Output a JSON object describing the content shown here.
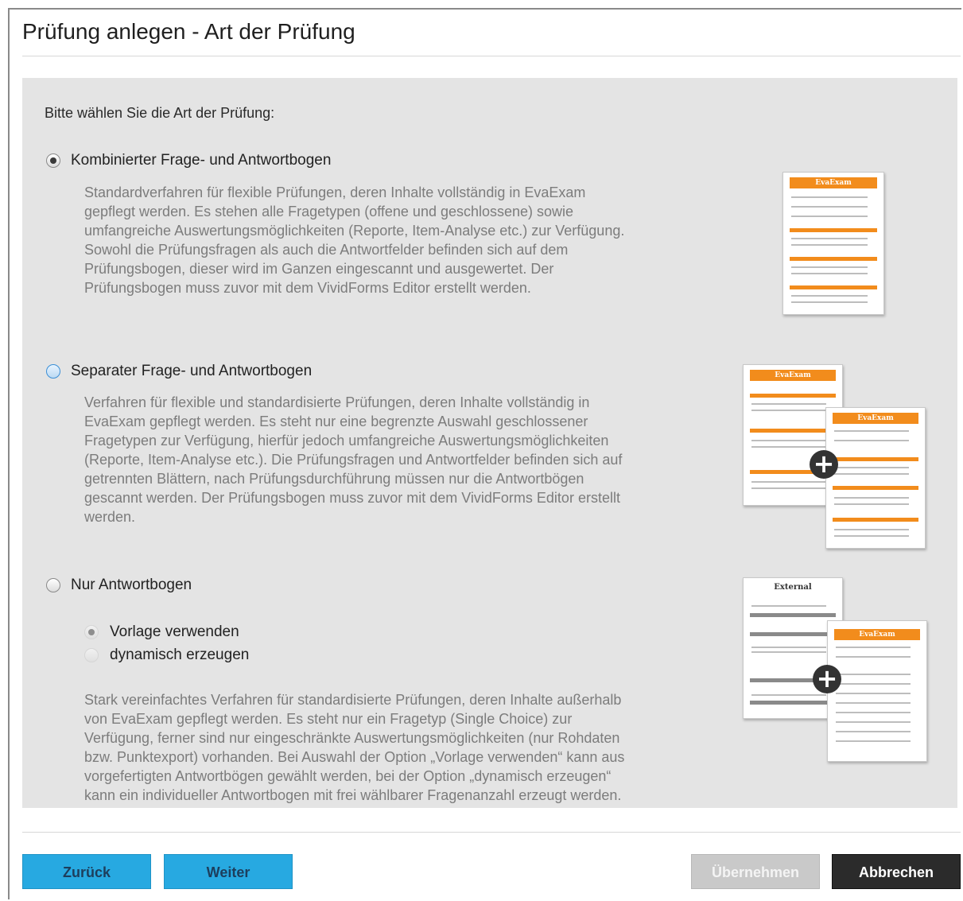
{
  "dialog": {
    "title": "Prüfung anlegen - Art der Prüfung"
  },
  "prompt": "Bitte wählen Sie die Art der Prüfung:",
  "options": [
    {
      "label": "Kombinierter Frage- und Antwortbogen",
      "selected": true,
      "description": "Standardverfahren für flexible Prüfungen, deren Inhalte vollständig in EvaExam\ngepflegt werden. Es stehen alle Fragetypen (offene und geschlossene) sowie\numfangreiche Auswertungsmöglichkeiten (Reporte, Item-Analyse etc.) zur Verfügung.\nSowohl die Prüfungsfragen als auch die Antwortfelder befinden sich auf dem\nPrüfungsbogen, dieser wird im Ganzen eingescannt und ausgewertet. Der\nPrüfungsbogen muss zuvor mit dem VividForms Editor erstellt werden."
    },
    {
      "label": "Separater Frage- und Antwortbogen",
      "selected": false,
      "description": "Verfahren für flexible und standardisierte Prüfungen, deren Inhalte vollständig in\nEvaExam gepflegt werden. Es steht nur eine begrenzte Auswahl geschlossener\nFragetypen zur Verfügung, hierfür jedoch umfangreiche Auswertungsmöglichkeiten\n(Reporte, Item-Analyse etc.). Die Prüfungsfragen und Antwortfelder befinden sich auf\ngetrennten Blättern, nach Prüfungsdurchführung müssen nur die Antwortbögen\ngescannt werden. Der Prüfungsbogen muss zuvor mit dem VividForms Editor erstellt\nwerden."
    },
    {
      "label": "Nur Antwortbogen",
      "selected": false,
      "suboptions": [
        {
          "label": "Vorlage verwenden",
          "selected": true
        },
        {
          "label": "dynamisch erzeugen",
          "selected": false
        }
      ],
      "description": "Stark vereinfachtes Verfahren für standardisierte Prüfungen, deren Inhalte außerhalb\nvon EvaExam gepflegt werden. Es steht nur ein Fragetyp (Single Choice) zur\nVerfügung, ferner sind nur eingeschränkte Auswertungsmöglichkeiten (nur Rohdaten\nbzw. Punktexport) vorhanden. Bei Auswahl der Option „Vorlage verwenden“ kann aus\nvorgefertigten Antwortbögen gewählt werden, bei der Option „dynamisch erzeugen“\nkann ein individueller Antwortbogen mit frei wählbarer Fragenanzahl erzeugt werden."
    }
  ],
  "thumbnails": {
    "brand": "EvaExam",
    "external": "External",
    "plus": "+"
  },
  "buttons": {
    "back": "Zurück",
    "next": "Weiter",
    "apply": "Übernehmen",
    "cancel": "Abbrechen"
  },
  "colors": {
    "accent_blue": "#27a9e1",
    "orange": "#f28c1c",
    "dark_button": "#2b2b2b",
    "panel_bg": "#e4e4e4"
  }
}
